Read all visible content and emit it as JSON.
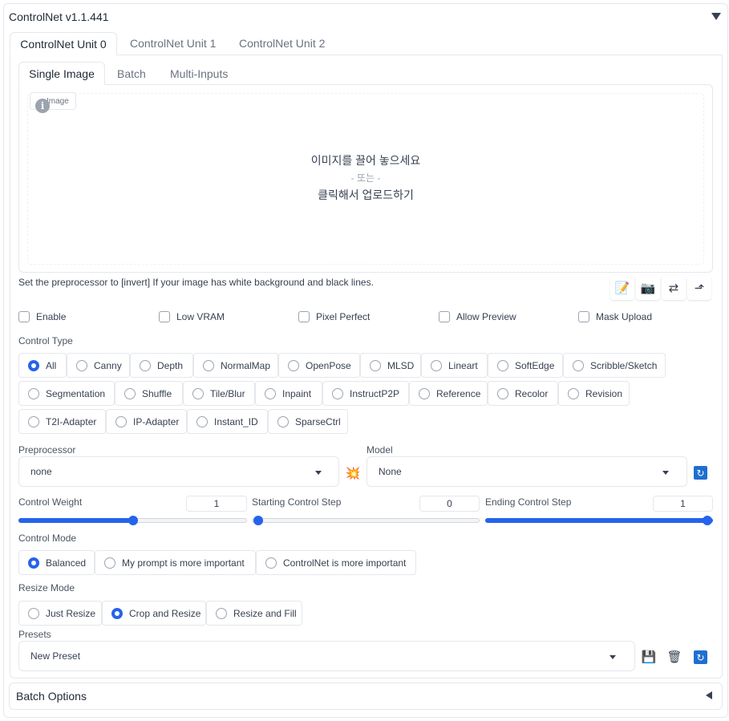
{
  "panel": {
    "title": "ControlNet v1.1.441"
  },
  "unit_tabs": [
    "ControlNet Unit 0",
    "ControlNet Unit 1",
    "ControlNet Unit 2"
  ],
  "input_tabs": [
    "Single Image",
    "Batch",
    "Multi-Inputs"
  ],
  "image_area": {
    "badge": "Image",
    "drop_line1": "이미지를 끌어 놓으세요",
    "drop_line2": "- 또는 -",
    "drop_line3": "클릭해서 업로드하기"
  },
  "hint": "Set the preprocessor to [invert] If your image has white background and black lines.",
  "toolbar_icons": [
    "edit-icon",
    "camera-icon",
    "swap-icon",
    "send-dimensions-icon"
  ],
  "checkboxes": [
    "Enable",
    "Low VRAM",
    "Pixel Perfect",
    "Allow Preview",
    "Mask Upload"
  ],
  "control_type": {
    "label": "Control Type",
    "selected": "All",
    "options": [
      "All",
      "Canny",
      "Depth",
      "NormalMap",
      "OpenPose",
      "MLSD",
      "Lineart",
      "SoftEdge",
      "Scribble/Sketch",
      "Segmentation",
      "Shuffle",
      "Tile/Blur",
      "Inpaint",
      "InstructP2P",
      "Reference",
      "Recolor",
      "Revision",
      "T2I-Adapter",
      "IP-Adapter",
      "Instant_ID",
      "SparseCtrl"
    ]
  },
  "preprocessor": {
    "label": "Preprocessor",
    "value": "none"
  },
  "model": {
    "label": "Model",
    "value": "None"
  },
  "sliders": [
    {
      "label": "Control Weight",
      "value": "1",
      "fraction": 0.5
    },
    {
      "label": "Starting Control Step",
      "value": "0",
      "fraction": 0.0
    },
    {
      "label": "Ending Control Step",
      "value": "1",
      "fraction": 1.0
    }
  ],
  "control_mode": {
    "label": "Control Mode",
    "selected": "Balanced",
    "options": [
      "Balanced",
      "My prompt is more important",
      "ControlNet is more important"
    ]
  },
  "resize_mode": {
    "label": "Resize Mode",
    "selected": "Crop and Resize",
    "options": [
      "Just Resize",
      "Crop and Resize",
      "Resize and Fill"
    ]
  },
  "presets": {
    "label": "Presets",
    "value": "New Preset"
  },
  "batch_options": {
    "label": "Batch Options"
  },
  "colors": {
    "accent": "#2563eb",
    "border": "#e5e7eb"
  }
}
